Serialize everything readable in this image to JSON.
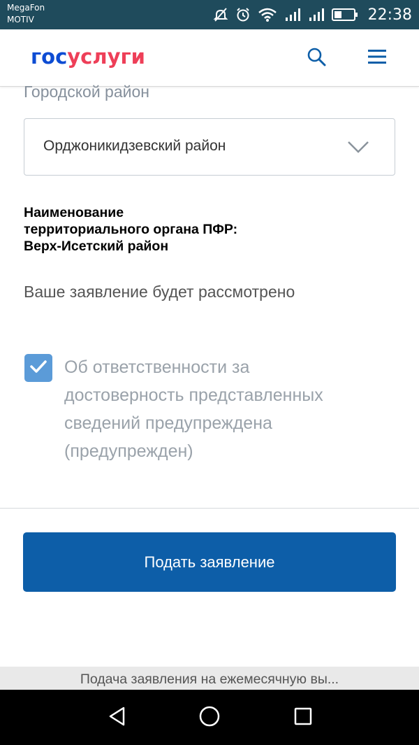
{
  "status_bar": {
    "carrier_line1": "MegaFon",
    "carrier_line2": "MOTIV",
    "time": "22:38",
    "icons": [
      "mute-icon",
      "alarm-icon",
      "wifi-icon",
      "signal-icon",
      "signal-icon",
      "battery-icon"
    ]
  },
  "header": {
    "logo_part1": "гос",
    "logo_part2": "услуги",
    "icons": [
      "search-icon",
      "menu-icon"
    ],
    "colors": {
      "logo_blue": "#0d4cd3",
      "logo_red": "#ee3f58",
      "icon": "#0d5ea8"
    }
  },
  "form": {
    "district_label": "Городской район",
    "district_value": "Орджоникидзевский район",
    "org_lines": [
      "Наименование",
      "территориального органа ПФР:",
      "Верх-Исетский район"
    ],
    "note": "Ваше заявление будет рассмотрено",
    "checkbox_checked": true,
    "checkbox_lines": [
      "Об ответственности за",
      "достоверность представленных",
      "сведений предупреждена",
      "(предупрежден)"
    ],
    "submit_label": "Подать заявление"
  },
  "bottom_title": "Подача заявления на ежемесячную вы...",
  "nav_bar": {
    "icons": [
      "back-icon",
      "home-icon",
      "recent-apps-icon"
    ]
  },
  "colors": {
    "status_bar": "#1f4b5c",
    "button": "#0d5ea8",
    "checkbox": "#5b9bd8"
  }
}
